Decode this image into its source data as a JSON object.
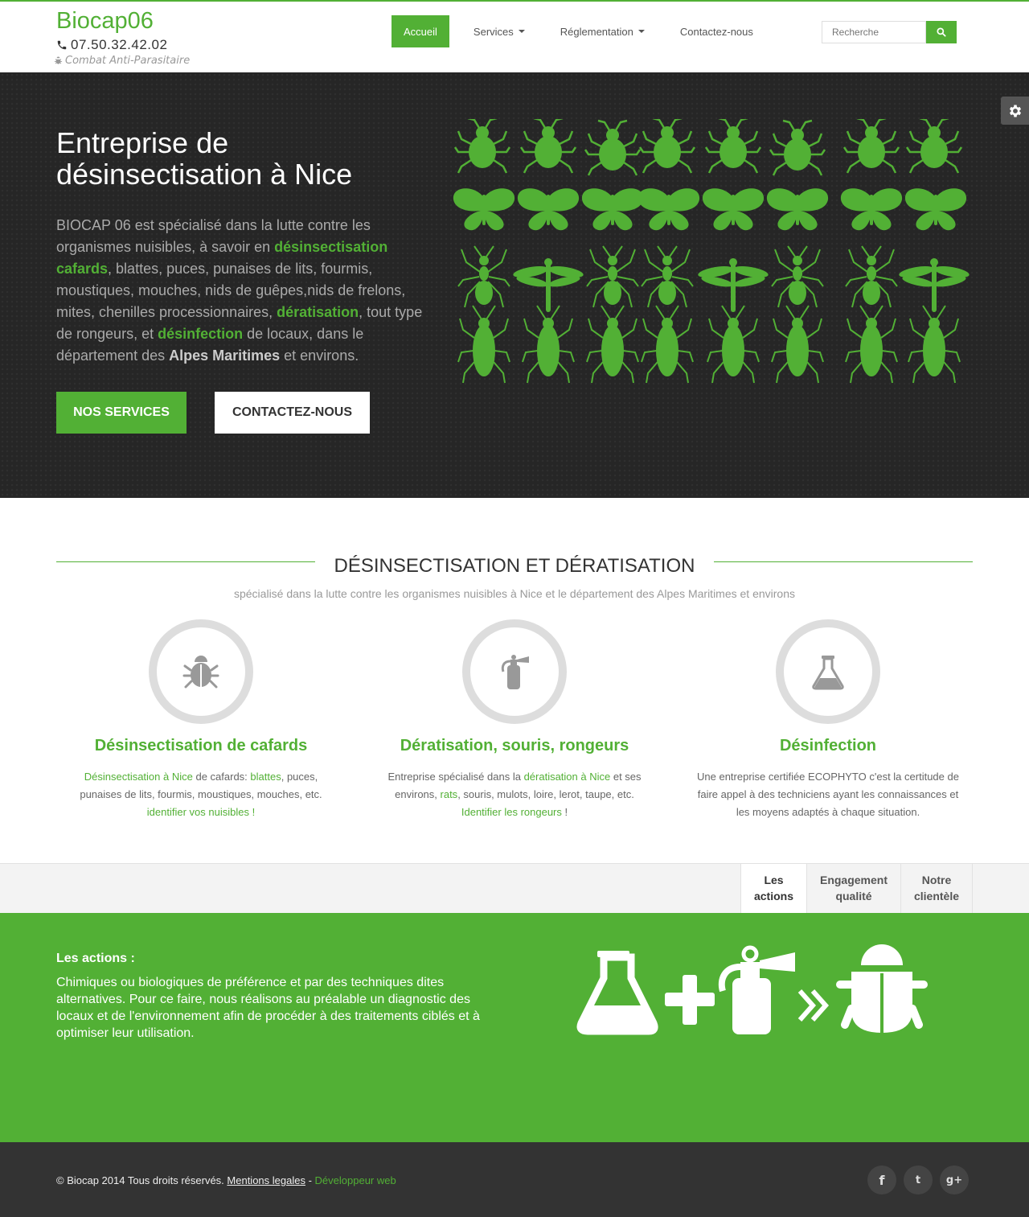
{
  "header": {
    "brand": "Biocap06",
    "phone": "07.50.32.42.02",
    "tagline": "Combat Anti-Parasitaire",
    "nav": [
      {
        "label": "Accueil",
        "active": true
      },
      {
        "label": "Services",
        "dropdown": true
      },
      {
        "label": "Réglementation",
        "dropdown": true
      },
      {
        "label": "Contactez-nous"
      }
    ],
    "search_placeholder": "Recherche"
  },
  "hero": {
    "title": "Entreprise de désinsectisation à Nice",
    "p_1": "BIOCAP 06 est spécialisé dans la lutte contre les organismes nuisibles, à savoir en ",
    "p_link_1": "désinsectisation cafards",
    "p_2": ", blattes, puces, punaises de lits, fourmis, moustiques, mouches, nids de guêpes,nids de frelons, mites, chenilles processionnaires, ",
    "p_link_2": "dératisation",
    "p_3": ", tout type de rongeurs, et ",
    "p_link_3": "désinfection",
    "p_4": " de locaux, dans le département des ",
    "p_strong": "Alpes Maritimes",
    "p_5": " et environs.",
    "btn_services": "NOS SERVICES",
    "btn_contact": "CONTACTEZ-NOUS"
  },
  "section": {
    "title": "DÉSINSECTISATION ET DÉRATISATION",
    "subtitle": "spécialisé dans la lutte contre les organismes nuisibles à Nice et le département des Alpes Maritimes et environs",
    "features": [
      {
        "icon": "bug-icon",
        "title": "Désinsectisation de cafards",
        "link_1": "Désinsectisation à Nice",
        "text_1": " de cafards: ",
        "link_2": "blattes",
        "text_2": ", puces, punaises de lits, fourmis, moustiques, mouches, etc. ",
        "link_3": "identifier vos nuisibles !",
        "text_3": ""
      },
      {
        "icon": "extinguisher-icon",
        "title": "Dératisation, souris, rongeurs",
        "text_0": "Entreprise spécialisé dans la ",
        "link_1": "dératisation à Nice",
        "text_1": " et ses environs, ",
        "link_2": "rats",
        "text_2": ", souris, mulots, loire, lerot, taupe, etc. ",
        "link_3": "Identifier les rongeurs",
        "text_3": " !"
      },
      {
        "icon": "flask-icon",
        "title": "Désinfection",
        "text": "Une entreprise certifiée ECOPHYTO c'est la certitude de faire appel à des techniciens ayant les connaissances et les moyens adaptés à chaque situation."
      }
    ]
  },
  "tabs": [
    {
      "label": "Les actions",
      "active": true
    },
    {
      "label": "Engagement qualité"
    },
    {
      "label": "Notre clientèle"
    }
  ],
  "panel": {
    "heading": "Les actions :",
    "text": "Chimiques ou biologiques de préférence et par des techniques dites alternatives. Pour ce faire, nous réalisons au préalable un diagnostic des locaux et de l'environnement afin de procéder à des traitements ciblés et à optimiser leur utilisation."
  },
  "footer": {
    "copyright": "© Biocap 2014 Tous droits réservés.",
    "legal": "Mentions legales",
    "sep": " - ",
    "dev": "Développeur web",
    "social": [
      {
        "icon": "facebook-icon",
        "glyph": "f"
      },
      {
        "icon": "twitter-icon",
        "glyph": "t"
      },
      {
        "icon": "google-plus-icon",
        "glyph": "g+"
      }
    ]
  },
  "colors": {
    "accent": "#52b035",
    "hero_bg": "#262626",
    "footer_bg": "#333333"
  }
}
